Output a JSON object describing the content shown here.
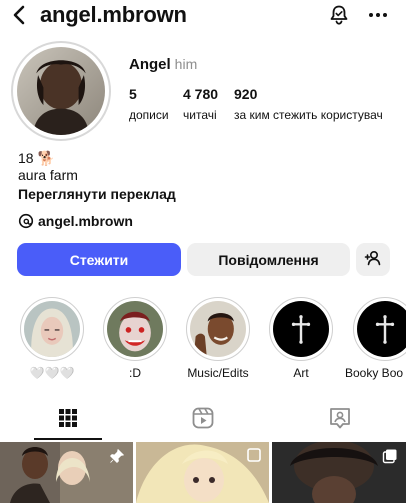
{
  "header": {
    "username": "angel.mbrown",
    "back_icon": "arrow-left-icon",
    "notification_icon": "bell-icon",
    "more_icon": "more-horizontal-icon"
  },
  "profile": {
    "display_name": "Angel",
    "pronouns": "him",
    "avatar_icon": "profile-photo",
    "stats": [
      {
        "value": "5",
        "label": "дописи"
      },
      {
        "value": "4 780",
        "label": "читачі"
      },
      {
        "value": "920",
        "label": "за ким стежить користувач"
      }
    ],
    "bio": {
      "line1": "18",
      "line1_emoji": "🐕",
      "line2": "aura farm",
      "translate_link": "Переглянути переклад"
    },
    "threads": {
      "icon": "threads-icon",
      "handle": "angel.mbrown"
    }
  },
  "actions": {
    "follow_label": "Стежити",
    "message_label": "Повідомлення",
    "add_user_icon": "add-user-icon"
  },
  "highlights": [
    {
      "label": "🤍🤍🤍",
      "cover": "girl-photo"
    },
    {
      "label": ":D",
      "cover": "clown-photo"
    },
    {
      "label": "Music/Edits",
      "cover": "selfie-photo"
    },
    {
      "label": "Art",
      "cover": "cross-icon"
    },
    {
      "label": "Booky Boo",
      "cover": "cross-icon"
    }
  ],
  "tabs": [
    {
      "name": "posts",
      "icon": "grid-icon",
      "active": true
    },
    {
      "name": "reels",
      "icon": "reels-icon",
      "active": false
    },
    {
      "name": "tagged",
      "icon": "tagged-icon",
      "active": false
    }
  ],
  "grid_posts": [
    {
      "icon": "pin-icon"
    },
    {
      "icon": ""
    },
    {
      "icon": "carousel-icon"
    }
  ],
  "colors": {
    "follow_button": "#4a5df9",
    "secondary_button": "#efefef",
    "text": "#111111",
    "muted": "#8e8e8e"
  }
}
